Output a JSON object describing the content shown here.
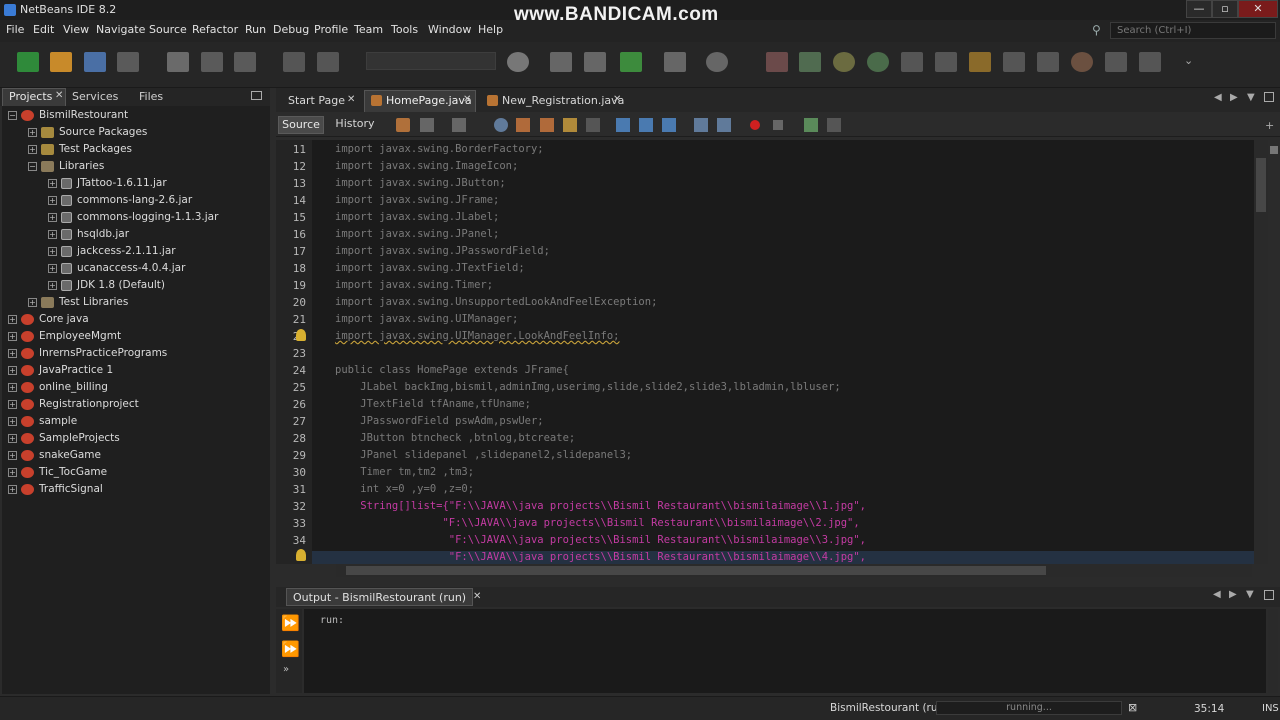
{
  "window": {
    "title": "NetBeans IDE 8.2",
    "watermark": "www.BANDICAM.com"
  },
  "menu": [
    "File",
    "Edit",
    "View",
    "Navigate",
    "Source",
    "Refactor",
    "Run",
    "Debug",
    "Profile",
    "Team",
    "Tools",
    "Window",
    "Help"
  ],
  "search": {
    "placeholder": "Search (Ctrl+I)"
  },
  "left_panel": {
    "tabs": [
      "Projects",
      "Services",
      "Files"
    ],
    "tree": [
      {
        "label": "BismilRestourant",
        "depth": 0,
        "icon": "project",
        "exp": "-"
      },
      {
        "label": "Source Packages",
        "depth": 1,
        "icon": "package",
        "exp": "+"
      },
      {
        "label": "Test Packages",
        "depth": 1,
        "icon": "package",
        "exp": "+"
      },
      {
        "label": "Libraries",
        "depth": 1,
        "icon": "library",
        "exp": "-"
      },
      {
        "label": "JTattoo-1.6.11.jar",
        "depth": 2,
        "icon": "jar",
        "exp": "+"
      },
      {
        "label": "commons-lang-2.6.jar",
        "depth": 2,
        "icon": "jar",
        "exp": "+"
      },
      {
        "label": "commons-logging-1.1.3.jar",
        "depth": 2,
        "icon": "jar",
        "exp": "+"
      },
      {
        "label": "hsqldb.jar",
        "depth": 2,
        "icon": "jar",
        "exp": "+"
      },
      {
        "label": "jackcess-2.1.11.jar",
        "depth": 2,
        "icon": "jar",
        "exp": "+"
      },
      {
        "label": "ucanaccess-4.0.4.jar",
        "depth": 2,
        "icon": "jar",
        "exp": "+"
      },
      {
        "label": "JDK 1.8 (Default)",
        "depth": 2,
        "icon": "jar",
        "exp": "+"
      },
      {
        "label": "Test Libraries",
        "depth": 1,
        "icon": "library",
        "exp": "+"
      },
      {
        "label": "Core java",
        "depth": 0,
        "icon": "project",
        "exp": "+"
      },
      {
        "label": "EmployeeMgmt",
        "depth": 0,
        "icon": "project",
        "exp": "+"
      },
      {
        "label": "InrernsPracticePrograms",
        "depth": 0,
        "icon": "project",
        "exp": "+"
      },
      {
        "label": "JavaPractice 1",
        "depth": 0,
        "icon": "project",
        "exp": "+"
      },
      {
        "label": "online_billing",
        "depth": 0,
        "icon": "project",
        "exp": "+"
      },
      {
        "label": "Registrationproject",
        "depth": 0,
        "icon": "project",
        "exp": "+"
      },
      {
        "label": "sample",
        "depth": 0,
        "icon": "project",
        "exp": "+"
      },
      {
        "label": "SampleProjects",
        "depth": 0,
        "icon": "project",
        "exp": "+"
      },
      {
        "label": "snakeGame",
        "depth": 0,
        "icon": "project",
        "exp": "+"
      },
      {
        "label": "Tic_TocGame",
        "depth": 0,
        "icon": "project",
        "exp": "+"
      },
      {
        "label": "TrafficSignal",
        "depth": 0,
        "icon": "project",
        "exp": "+"
      }
    ]
  },
  "editor": {
    "tabs": [
      "Start Page",
      "HomePage.java",
      "New_Registration.java"
    ],
    "active_tab": "HomePage.java",
    "view_buttons": [
      "Source",
      "History"
    ],
    "lines": [
      {
        "n": "11",
        "t": "import javax.swing.BorderFactory;",
        "c": "im"
      },
      {
        "n": "12",
        "t": "import javax.swing.ImageIcon;",
        "c": "im"
      },
      {
        "n": "13",
        "t": "import javax.swing.JButton;",
        "c": "im"
      },
      {
        "n": "14",
        "t": "import javax.swing.JFrame;",
        "c": "im"
      },
      {
        "n": "15",
        "t": "import javax.swing.JLabel;",
        "c": "im"
      },
      {
        "n": "16",
        "t": "import javax.swing.JPanel;",
        "c": "im"
      },
      {
        "n": "17",
        "t": "import javax.swing.JPasswordField;",
        "c": "im"
      },
      {
        "n": "18",
        "t": "import javax.swing.JTextField;",
        "c": "im"
      },
      {
        "n": "19",
        "t": "import javax.swing.Timer;",
        "c": "im"
      },
      {
        "n": "20",
        "t": "import javax.swing.UnsupportedLookAndFeelException;",
        "c": "im"
      },
      {
        "n": "21",
        "t": "import javax.swing.UIManager;",
        "c": "im"
      },
      {
        "n": "22",
        "t": "import javax.swing.UIManager.LookAndFeelInfo;",
        "c": "im"
      },
      {
        "n": "23",
        "t": "",
        "c": ""
      },
      {
        "n": "24",
        "t": "public class HomePage extends JFrame{",
        "c": "im"
      },
      {
        "n": "25",
        "t": "    JLabel backImg,bismil,adminImg,userimg,slide,slide2,slide3,lbladmin,lbluser;",
        "c": "im"
      },
      {
        "n": "26",
        "t": "    JTextField tfAname,tfUname;",
        "c": "im"
      },
      {
        "n": "27",
        "t": "    JPasswordField pswAdm,pswUer;",
        "c": "im"
      },
      {
        "n": "28",
        "t": "    JButton btncheck ,btnlog,btcreate;",
        "c": "im"
      },
      {
        "n": "29",
        "t": "    JPanel slidepanel ,slidepanel2,slidepanel3;",
        "c": "im"
      },
      {
        "n": "30",
        "t": "    Timer tm,tm2 ,tm3;",
        "c": "im"
      },
      {
        "n": "31",
        "t": "    int x=0 ,y=0 ,z=0;",
        "c": "im"
      },
      {
        "n": "32",
        "t": "    String[]list={\"F:\\\\JAVA\\\\java projects\\\\Bismil Restaurant\\\\bismilaimage\\\\1.jpg\",",
        "c": "kw"
      },
      {
        "n": "33",
        "t": "                 \"F:\\\\JAVA\\\\java projects\\\\Bismil Restaurant\\\\bismilaimage\\\\2.jpg\",",
        "c": "kw"
      },
      {
        "n": "34",
        "t": "                  \"F:\\\\JAVA\\\\java projects\\\\Bismil Restaurant\\\\bismilaimage\\\\3.jpg\",",
        "c": "kw"
      },
      {
        "n": "",
        "t": "                  \"F:\\\\JAVA\\\\java projects\\\\Bismil Restaurant\\\\bismilaimage\\\\4.jpg\",",
        "c": "kw"
      }
    ]
  },
  "output": {
    "title": "Output - BismilRestourant (run)",
    "text": "run:"
  },
  "status": {
    "task": "BismilRestourant (run)",
    "progress": "running...",
    "position": "35:14",
    "mode": "INS"
  },
  "colors": {
    "background": "#1b1b1b",
    "import_text": "#7a7a7a",
    "string_text": "#c43ba3",
    "accent": "#3a7bd5"
  }
}
